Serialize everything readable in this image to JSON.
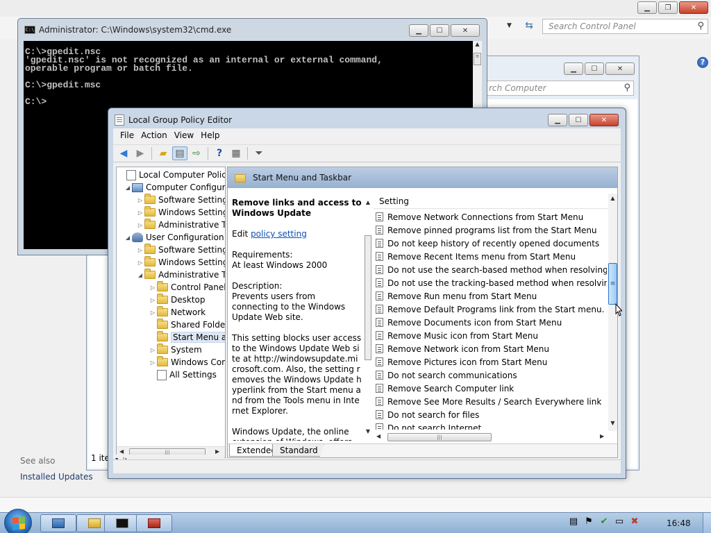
{
  "control_panel": {
    "search_placeholder": "Search Control Panel",
    "see_also": "See also",
    "installed_updates": "Installed Updates"
  },
  "bg_window": {
    "search_placeholder": "rch Computer",
    "status": "1 ite"
  },
  "cmd": {
    "title": "Administrator: C:\\Windows\\system32\\cmd.exe",
    "console_text": "C:\\>gpedit.nsc\n'gpedit.nsc' is not recognized as an internal or external command,\noperable program or batch file.\n\nC:\\>gpedit.msc\n\nC:\\>"
  },
  "gpedit": {
    "title": "Local Group Policy Editor",
    "menu": [
      "File",
      "Action",
      "View",
      "Help"
    ],
    "tree": [
      {
        "label": "Local Computer Policy",
        "level": 0,
        "arrow": "",
        "icon": "doc"
      },
      {
        "label": "Computer Configura",
        "level": 1,
        "arrow": "◢",
        "icon": "pc"
      },
      {
        "label": "Software Settings",
        "level": 2,
        "arrow": "▷",
        "icon": "folder"
      },
      {
        "label": "Windows Setting",
        "level": 2,
        "arrow": "▷",
        "icon": "folder"
      },
      {
        "label": "Administrative Te",
        "level": 2,
        "arrow": "▷",
        "icon": "folder"
      },
      {
        "label": "User Configuration",
        "level": 1,
        "arrow": "◢",
        "icon": "user"
      },
      {
        "label": "Software Settings",
        "level": 2,
        "arrow": "▷",
        "icon": "folder"
      },
      {
        "label": "Windows Setting",
        "level": 2,
        "arrow": "▷",
        "icon": "folder"
      },
      {
        "label": "Administrative Te",
        "level": 2,
        "arrow": "◢",
        "icon": "folder"
      },
      {
        "label": "Control Panel",
        "level": 3,
        "arrow": "▷",
        "icon": "folder"
      },
      {
        "label": "Desktop",
        "level": 3,
        "arrow": "▷",
        "icon": "folder"
      },
      {
        "label": "Network",
        "level": 3,
        "arrow": "▷",
        "icon": "folder"
      },
      {
        "label": "Shared Folder",
        "level": 3,
        "arrow": "",
        "icon": "folder"
      },
      {
        "label": "Start Menu ar",
        "level": 3,
        "arrow": "",
        "icon": "folder",
        "selected": true
      },
      {
        "label": "System",
        "level": 3,
        "arrow": "▷",
        "icon": "folder"
      },
      {
        "label": "Windows Cor",
        "level": 3,
        "arrow": "▷",
        "icon": "folder"
      },
      {
        "label": "All Settings",
        "level": 3,
        "arrow": "",
        "icon": "doc"
      }
    ],
    "header_title": "Start Menu and Taskbar",
    "extended": {
      "heading": "Remove links and access to Windows Update",
      "edit_prefix": "Edit ",
      "edit_link": "policy setting",
      "requirements_label": "Requirements:",
      "requirements_value": "At least Windows 2000",
      "description_label": "Description:",
      "description_p1": "Prevents users from connecting to the Windows Update Web site.",
      "description_p2": "This setting blocks user access to the Windows Update Web site at http://windowsupdate.microsoft.com. Also, the setting removes the Windows Update hyperlink from the Start menu and from the Tools menu in Internet Explorer.",
      "description_p3": "Windows Update, the online extension of Windows, offers software updates to keep a user's"
    },
    "settings_header": "Setting",
    "settings": [
      "Remove Network Connections from Start Menu",
      "Remove pinned programs list from the Start Menu",
      "Do not keep history of recently opened documents",
      "Remove Recent Items menu from Start Menu",
      "Do not use the search-based method when resolving shell s",
      "Do not use the tracking-based method when resolving shel",
      "Remove Run menu from Start Menu",
      "Remove Default Programs link from the Start menu.",
      "Remove Documents icon from Start Menu",
      "Remove Music icon from Start Menu",
      "Remove Network icon from Start Menu",
      "Remove Pictures icon from Start Menu",
      "Do not search communications",
      "Remove Search Computer link",
      "Remove See More Results / Search Everywhere link",
      "Do not search for files",
      "Do not search Internet"
    ],
    "tabs": [
      "Extended",
      "Standard"
    ]
  },
  "taskbar": {
    "clock": "16:48"
  }
}
